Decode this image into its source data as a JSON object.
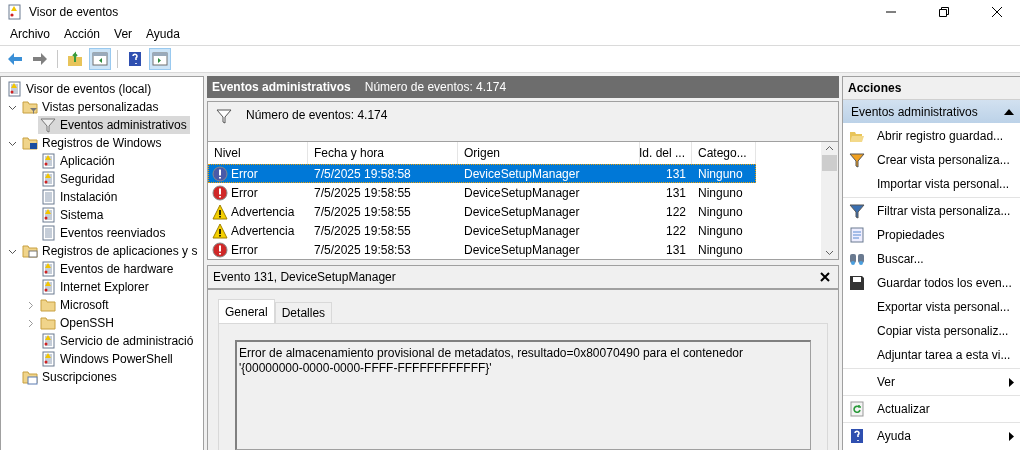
{
  "window": {
    "title": "Visor de eventos"
  },
  "menu": [
    "Archivo",
    "Acción",
    "Ver",
    "Ayuda"
  ],
  "toolbar": [
    {
      "kind": "back",
      "pressed": false
    },
    {
      "kind": "forward",
      "pressed": false
    },
    {
      "kind": "up",
      "pressed": false
    },
    {
      "kind": "tree",
      "pressed": true
    },
    {
      "kind": "help",
      "pressed": false
    },
    {
      "kind": "actions",
      "pressed": true
    }
  ],
  "tree": [
    {
      "label": "Visor de eventos (local)",
      "kind": "root",
      "selected": false,
      "children": [
        {
          "label": "Vistas personalizadas",
          "kind": "viewsfolder",
          "selected": false,
          "expanded": true,
          "children": [
            {
              "label": "Eventos administrativos",
              "kind": "filter",
              "selected": true
            }
          ]
        },
        {
          "label": "Registros de Windows",
          "kind": "winfolder",
          "selected": false,
          "expanded": true,
          "children": [
            {
              "label": "Aplicación",
              "kind": "log",
              "selected": false
            },
            {
              "label": "Seguridad",
              "kind": "log",
              "selected": false
            },
            {
              "label": "Instalación",
              "kind": "plainlog",
              "selected": false
            },
            {
              "label": "Sistema",
              "kind": "log",
              "selected": false
            },
            {
              "label": "Eventos reenviados",
              "kind": "plainlog",
              "selected": false
            }
          ]
        },
        {
          "label": "Registros de aplicaciones y s",
          "kind": "appfolder",
          "selected": false,
          "expanded": true,
          "children": [
            {
              "label": "Eventos de hardware",
              "kind": "log",
              "selected": false
            },
            {
              "label": "Internet Explorer",
              "kind": "log",
              "selected": false
            },
            {
              "label": "Microsoft",
              "kind": "folder",
              "selected": false,
              "expanded": false
            },
            {
              "label": "OpenSSH",
              "kind": "folder",
              "selected": false,
              "expanded": false
            },
            {
              "label": "Servicio de administració",
              "kind": "log",
              "selected": false
            },
            {
              "label": "Windows PowerShell",
              "kind": "log",
              "selected": false
            }
          ]
        },
        {
          "label": "Suscripciones",
          "kind": "subsfolder",
          "selected": false
        }
      ]
    }
  ],
  "center": {
    "title": "Eventos administrativos",
    "count": "Número de eventos: 4.174"
  },
  "filter_bar": {
    "text": "Número de eventos: 4.174"
  },
  "table": {
    "columns": [
      "Nivel",
      "Fecha y hora",
      "Origen",
      "Id. del ...",
      "Catego..."
    ],
    "rows": [
      {
        "kind": "error",
        "level": "Error",
        "date": "7/5/2025 19:58:58",
        "source": "DeviceSetupManager",
        "id": "131",
        "category": "Ninguno",
        "selected": true
      },
      {
        "kind": "error",
        "level": "Error",
        "date": "7/5/2025 19:58:55",
        "source": "DeviceSetupManager",
        "id": "131",
        "category": "Ninguno",
        "selected": false
      },
      {
        "kind": "warning",
        "level": "Advertencia",
        "date": "7/5/2025 19:58:55",
        "source": "DeviceSetupManager",
        "id": "122",
        "category": "Ninguno",
        "selected": false
      },
      {
        "kind": "warning",
        "level": "Advertencia",
        "date": "7/5/2025 19:58:55",
        "source": "DeviceSetupManager",
        "id": "122",
        "category": "Ninguno",
        "selected": false
      },
      {
        "kind": "error",
        "level": "Error",
        "date": "7/5/2025 19:58:53",
        "source": "DeviceSetupManager",
        "id": "131",
        "category": "Ninguno",
        "selected": false
      }
    ]
  },
  "details": {
    "title": "Evento 131, DeviceSetupManager",
    "tabs": [
      {
        "label": "General",
        "selected": true
      },
      {
        "label": "Detalles",
        "selected": false
      }
    ],
    "message": "Error de almacenamiento provisional de metadatos, resultado=0x80070490 para el contenedor '{00000000-0000-0000-FFFF-FFFFFFFFFFFF}'"
  },
  "actions": {
    "title": "Acciones",
    "section": {
      "label": "Eventos administrativos",
      "expanded": true
    },
    "groups": [
      [
        {
          "label": "Abrir registro guardad...",
          "kind": "open"
        },
        {
          "label": "Crear vista personaliza...",
          "kind": "create"
        },
        {
          "label": "Importar vista personal...",
          "kind": "none"
        }
      ],
      [
        {
          "label": "Filtrar vista personaliza...",
          "kind": "filter"
        },
        {
          "label": "Propiedades",
          "kind": "props"
        },
        {
          "label": "Buscar...",
          "kind": "find"
        },
        {
          "label": "Guardar todos los even...",
          "kind": "save"
        },
        {
          "label": "Exportar vista personal...",
          "kind": "none"
        },
        {
          "label": "Copiar vista personaliz...",
          "kind": "none"
        },
        {
          "label": "Adjuntar tarea a esta vi...",
          "kind": "none"
        }
      ],
      [
        {
          "label": "Ver",
          "kind": "none",
          "submenu": true
        }
      ],
      [
        {
          "label": "Actualizar",
          "kind": "refresh"
        }
      ],
      [
        {
          "label": "Ayuda",
          "kind": "help",
          "submenu": true
        }
      ]
    ]
  }
}
